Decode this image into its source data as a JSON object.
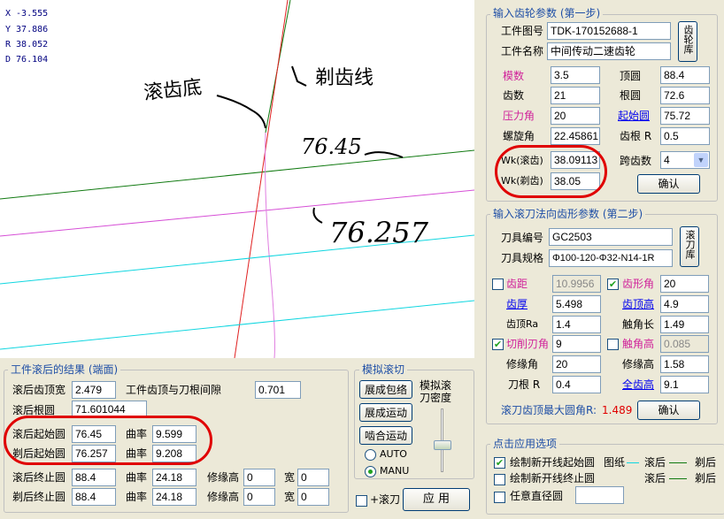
{
  "canvas": {
    "readouts": [
      "X -3.555",
      "Y 37.886",
      "R 38.052",
      "D 76.104"
    ],
    "annotations": {
      "hob_label": "滚齿底",
      "shave_label": "剃齿线",
      "value_a": "76.45",
      "value_b": "76.257"
    }
  },
  "step1": {
    "title": "输入齿轮参数 (第一步)",
    "drawing_no_label": "工件图号",
    "drawing_no_value": "TDK-170152688-1",
    "part_name_label": "工件名称",
    "part_name_value": "中间传动二速齿轮",
    "gear_lib_button": "齿轮库",
    "module_label": "模数",
    "module_value": "3.5",
    "tip_dia_label": "顶圆",
    "tip_dia_value": "88.4",
    "teeth_label": "齿数",
    "teeth_value": "21",
    "root_dia_label": "根圆",
    "root_dia_value": "72.6",
    "pressure_angle_label": "压力角",
    "pressure_angle_value": "20",
    "start_circle_label": "起始圆",
    "start_circle_value": "75.72",
    "helix_angle_label": "螺旋角",
    "helix_angle_value": "22.45861",
    "tip_r_label": "齿根 R",
    "tip_r_value": "0.5",
    "wk_hob_label": "Wk(滚齿)",
    "wk_hob_value": "38.09113",
    "span_teeth_label": "跨齿数",
    "span_teeth_value": "4",
    "wk_shave_label": "Wk(剃齿)",
    "wk_shave_value": "38.05",
    "confirm_button": "确认"
  },
  "step2": {
    "title": "输入滚刀法向齿形参数 (第二步)",
    "tool_no_label": "刀具编号",
    "tool_no_value": "GC2503",
    "tool_spec_label": "刀具规格",
    "tool_spec_value": "Φ100-120-Φ32-N14-1R",
    "hob_lib_button": "滚刀库",
    "pitch_label": "齿距",
    "pitch_value": "10.9956",
    "profile_angle_label": "齿形角",
    "profile_angle_value": "20",
    "thickness_label": "齿厚",
    "thickness_value": "5.498",
    "tip_height_label": "齿顶高",
    "tip_height_value": "4.9",
    "tip_ra_label": "齿顶Ra",
    "tip_ra_value": "1.4",
    "touch_len_label": "触角长",
    "touch_len_value": "1.49",
    "cut_angle_label": "切削刃角",
    "cut_angle_value": "9",
    "touch_height_label": "触角高",
    "touch_height_value": "0.085",
    "trim_height_label": "修缘高",
    "trim_height_value": "1.58",
    "trim_label": "修缘角",
    "trim_value": "20",
    "blade_r_label": "刀根 R",
    "blade_r_value": "0.4",
    "full_tip_label": "全齿高",
    "full_tip_value": "9.1",
    "max_radius_label": "滚刀齿顶最大圆角R:",
    "max_radius_value": "1.489",
    "confirm_button": "确认"
  },
  "apply": {
    "title": "点击应用选项",
    "opt1": "绘制新开线起始圆",
    "opt2": "绘制新开线终止圆",
    "opt3": "任意直径圆",
    "legend_title": "图纸",
    "legend_hob": "滚后",
    "legend_shave": "剃后"
  },
  "results": {
    "title": "工件滚后的结果 (端面)",
    "tip_width_label": "滚后齿顶宽",
    "tip_width_value": "2.479",
    "gap_label": "工件齿顶与刀根间隙",
    "gap_value": "0.701",
    "root_label": "滚后根圆",
    "root_value": "71.601044",
    "hob_start_label": "滚后起始圆",
    "hob_start_value": "76.45",
    "curv_label": "曲率",
    "hob_curv_value": "9.599",
    "shave_start_label": "剃后起始圆",
    "shave_start_value": "76.257",
    "shave_curv_value": "9.208",
    "hob_end_label": "滚后终止圆",
    "hob_end_value": "88.4",
    "hob_end_curv": "24.18",
    "shave_end_label": "剃后终止圆",
    "shave_end_value": "88.4",
    "shave_end_curv": "24.18",
    "trim_h_label": "修缘高",
    "trim_h_1": "0",
    "trim_h_2": "0",
    "width_label": "宽",
    "width_1": "0",
    "width_2": "0"
  },
  "simulation": {
    "title": "模拟滚切",
    "btn_generate": "展成包络",
    "btn_motion": "展成运动",
    "btn_mesh": "啮合运动",
    "density_label": "模拟滚刀密度",
    "auto_label": "AUTO",
    "manu_label": "MANU",
    "hob_check": "+滚刀",
    "apply_button": "应 用"
  }
}
